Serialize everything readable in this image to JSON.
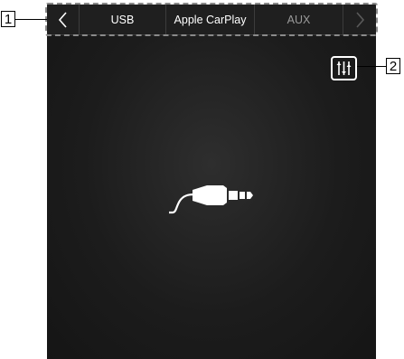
{
  "tabs": {
    "back_icon": "chevron-left-icon",
    "items": [
      {
        "label": "USB",
        "state": "normal"
      },
      {
        "label": "Apple CarPlay",
        "state": "normal"
      },
      {
        "label": "AUX",
        "state": "selected"
      }
    ],
    "next_icon": "chevron-right-icon"
  },
  "main": {
    "center_icon": "aux-jack-icon",
    "eq_button_icon": "equalizer-icon"
  },
  "callouts": {
    "tab_bar": "1",
    "eq_button": "2"
  },
  "colors": {
    "screen_background": "#1c1c1c",
    "tab_text": "#ffffff",
    "selected_tab_text": "#9a9a9a",
    "icon": "#ffffff"
  }
}
